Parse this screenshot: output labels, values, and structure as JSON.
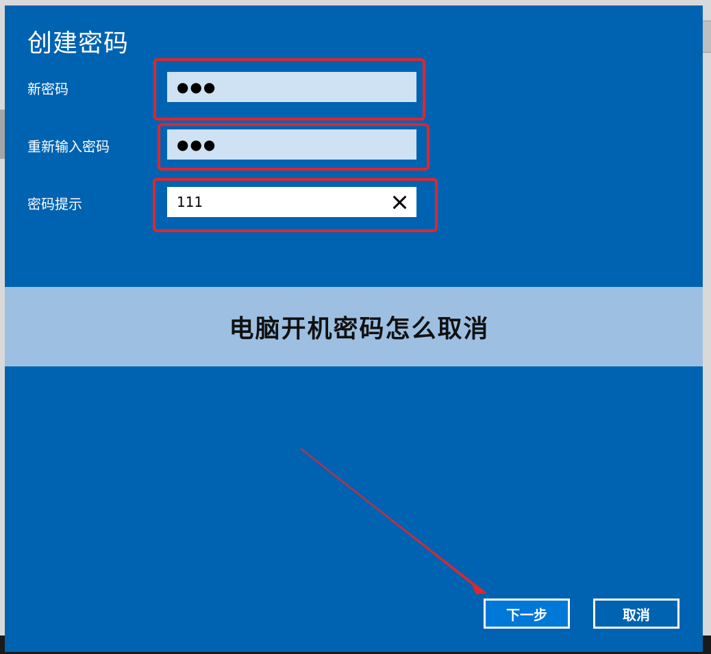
{
  "dialog": {
    "title": "创建密码",
    "fields": [
      {
        "label": "新密码",
        "value": "●●●"
      },
      {
        "label": "重新输入密码",
        "value": "●●●"
      },
      {
        "label": "密码提示",
        "value": "111"
      }
    ]
  },
  "banner": {
    "text": "电脑开机密码怎么取消"
  },
  "buttons": {
    "next": "下一步",
    "cancel": "取消"
  },
  "colors": {
    "dialog_bg": "#0063b1",
    "highlight": "#e0262e",
    "banner_bg": "#9dc0e2"
  },
  "icons": {
    "clear": "close-icon"
  }
}
